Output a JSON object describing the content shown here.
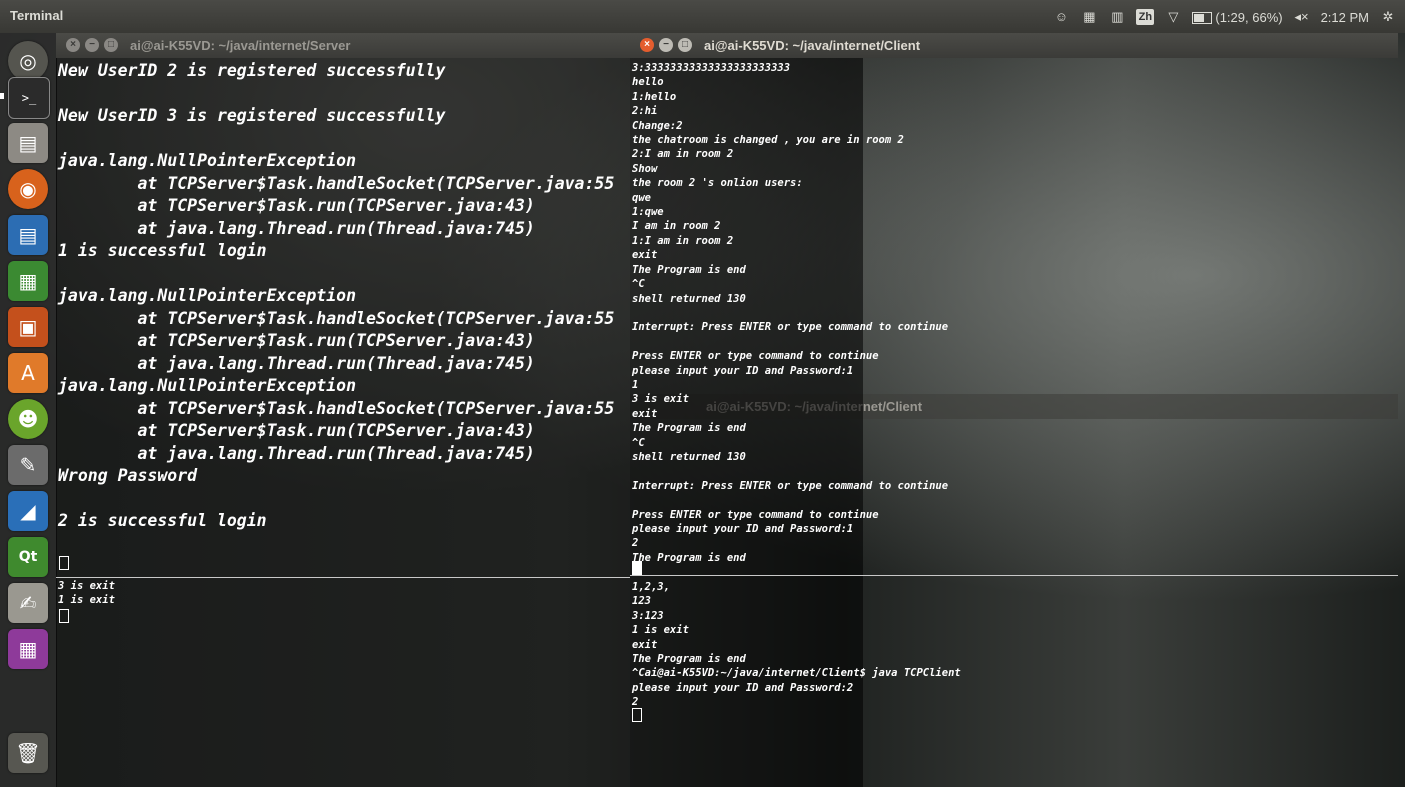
{
  "panel": {
    "title": "Terminal",
    "battery_text": "(1:29, 66%)",
    "clock": "2:12 PM",
    "input_method": "Zh"
  },
  "windows": {
    "server": {
      "title": "ai@ai-K55VD: ~/java/internet/Server",
      "output": "New UserID 2 is registered successfully\n\nNew UserID 3 is registered successfully\n\njava.lang.NullPointerException\n        at TCPServer$Task.handleSocket(TCPServer.java:55\n        at TCPServer$Task.run(TCPServer.java:43)\n        at java.lang.Thread.run(Thread.java:745)\n1 is successful login\n\njava.lang.NullPointerException\n        at TCPServer$Task.handleSocket(TCPServer.java:55\n        at TCPServer$Task.run(TCPServer.java:43)\n        at java.lang.Thread.run(Thread.java:745)\njava.lang.NullPointerException\n        at TCPServer$Task.handleSocket(TCPServer.java:55\n        at TCPServer$Task.run(TCPServer.java:43)\n        at java.lang.Thread.run(Thread.java:745)\nWrong Password\n\n2 is successful login"
    },
    "server_lower": {
      "output": "3 is exit\n1 is exit"
    },
    "client_main": {
      "title": "ai@ai-K55VD: ~/java/internet/Client",
      "output": "3:33333333333333333333333\nhello\n1:hello\n2:hi\nChange:2\nthe chatroom is changed , you are in room 2\n2:I am in room 2\nShow\nthe room 2 's onlion users:\nqwe\n1:qwe\nI am in room 2\n1:I am in room 2\nexit\nThe Program is end\n^C\nshell returned 130\n\nInterrupt: Press ENTER or type command to continue\n\nPress ENTER or type command to continue\nplease input your ID and Password:1\n1\n3 is exit\nexit\nThe Program is end\n^C\nshell returned 130\n\nInterrupt: Press ENTER or type command to continue\n\nPress ENTER or type command to continue\nplease input your ID and Password:1\n2\nThe Program is end"
    },
    "client_background": {
      "title": "ai@ai-K55VD: ~/java/internet/Client"
    },
    "client_lower": {
      "output": "1,2,3,\n123\n3:123\n1 is exit\nexit\nThe Program is end\n^Cai@ai-K55VD:~/java/internet/Client$ java TCPClient\nplease input your ID and Password:2\n2"
    }
  },
  "launcher_icons": [
    "ubuntu-dash-icon",
    "terminal-icon",
    "file-manager-icon",
    "firefox-icon",
    "writer-icon",
    "calc-icon",
    "impress-icon",
    "software-center-icon",
    "pidgin-icon",
    "settings-icon",
    "matlab-icon",
    "qt-creator-icon",
    "text-editor-icon",
    "workspace-switcher-icon",
    "trash-icon"
  ],
  "colors": {
    "close_button": "#e45d2e",
    "terminal_text": "#ffffff",
    "panel_bg": "#3c3c39"
  }
}
